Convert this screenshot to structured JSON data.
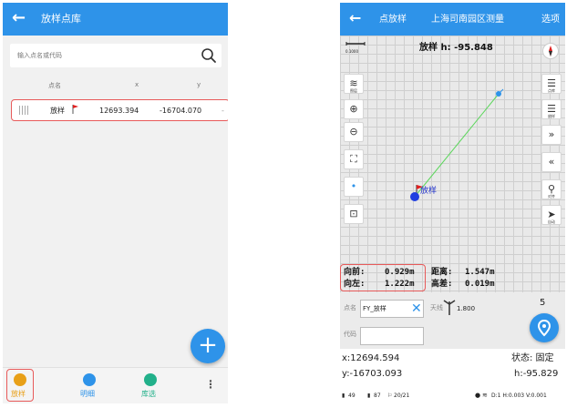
{
  "left": {
    "header": {
      "back_icon": "arrow-left-icon",
      "title": "放样点库"
    },
    "search": {
      "placeholder": "输入点名或代码",
      "icon": "search-icon"
    },
    "columns": {
      "name": "点名",
      "x": "x",
      "y": "y"
    },
    "rows": [
      {
        "grip_icon": "drag-handle-icon",
        "name": "放样",
        "flag_icon": "flag-icon",
        "x": "12693.394",
        "y": "-16704.070"
      }
    ],
    "fab": {
      "label": "+"
    },
    "bottom_nav": [
      {
        "label": "放样",
        "icon": "stakeout-icon",
        "color": "#e8a018",
        "active": true
      },
      {
        "label": "明细",
        "icon": "details-icon",
        "color": "#2e93e9",
        "active": false
      },
      {
        "label": "库选",
        "icon": "library-icon",
        "color": "#22b08a",
        "active": false
      }
    ],
    "more_icon": "more-vertical-icon"
  },
  "right": {
    "header": {
      "back_icon": "arrow-left-icon",
      "mode": "点放样",
      "project": "上海司南园区测量",
      "options": "选项"
    },
    "map": {
      "height_label": "放样 h: -95.848",
      "scale_label": "0.1000",
      "point_label": "放样",
      "left_tools": [
        "layers-icon",
        "zoom-in-icon",
        "zoom-out-icon",
        "fullscreen-icon",
        "locate-icon",
        "fit-extent-icon"
      ],
      "layers_label": "图层",
      "right_tools": [
        {
          "icon": "point-library-icon",
          "label": "点库"
        },
        {
          "icon": "stakeout-list-icon",
          "label": "放样"
        },
        {
          "icon": "next-icon",
          "label": ""
        },
        {
          "icon": "previous-icon",
          "label": ""
        },
        {
          "icon": "align-icon",
          "label": "对齐"
        },
        {
          "icon": "auto-icon",
          "label": "自动"
        }
      ],
      "compass_icon": "compass-icon"
    },
    "readout": {
      "forward_label": "向前:",
      "forward_value": "0.929m",
      "left_label": "向左:",
      "left_value": "1.222m",
      "distance_label": "距离:",
      "distance_value": "1.547m",
      "height_diff_label": "高差:",
      "height_diff_value": "0.019m"
    },
    "form": {
      "name_label": "点名",
      "name_value": "FY_放样",
      "antenna_label": "天线",
      "antenna_value": "1.800",
      "code_label": "代码",
      "code_value": "",
      "counter": "5"
    },
    "status": {
      "x": "x:12694.594",
      "y": "y:-16703.093",
      "state": "状态: 固定",
      "h": "h:-95.829"
    },
    "sysbar": {
      "battery": "49",
      "battery2": "87",
      "satellites": "20/21",
      "precision": "D:1 H:0.003 V:0.001"
    },
    "colors": {
      "accent": "#2e93e9",
      "highlight": "#e85a5a"
    }
  }
}
